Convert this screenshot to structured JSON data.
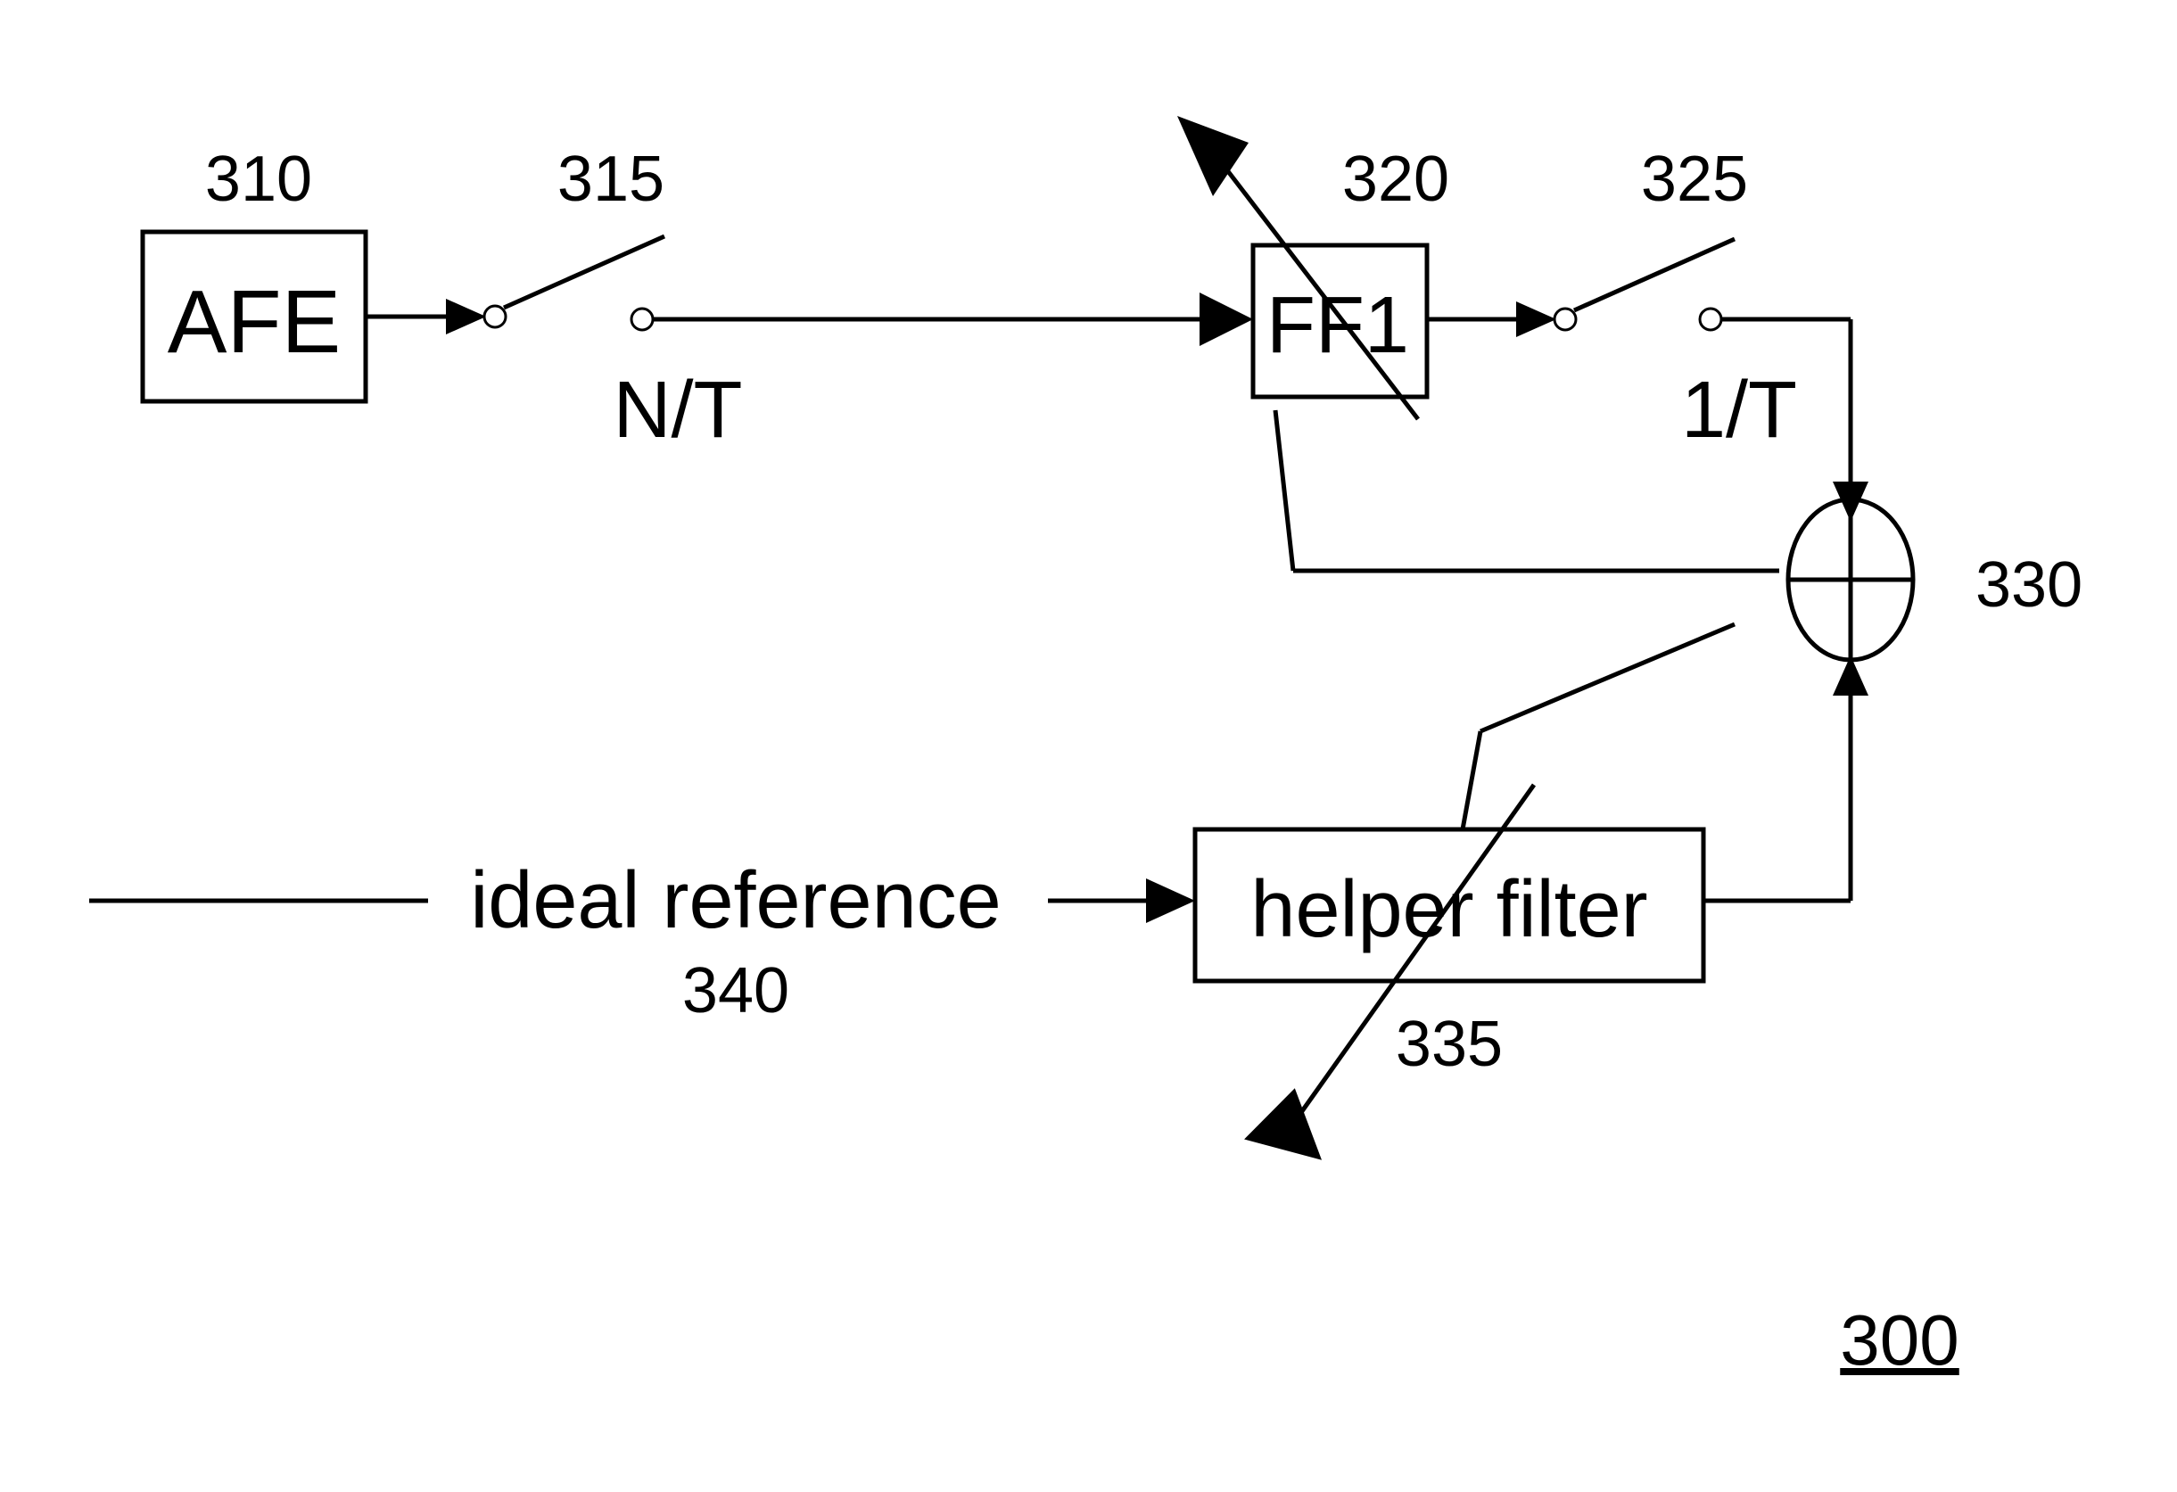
{
  "blocks": {
    "afe": {
      "label": "AFE",
      "ref": "310"
    },
    "ff1": {
      "label": "FF1",
      "ref": "320"
    },
    "helper": {
      "label": "helper filter",
      "ref": "335"
    },
    "summer_ref": "330"
  },
  "switches": {
    "s1": {
      "ref": "315",
      "rate": "N/T"
    },
    "s2": {
      "ref": "325",
      "rate": "1/T"
    }
  },
  "reference": {
    "label": "ideal reference",
    "ref": "340"
  },
  "figure_ref": "300"
}
